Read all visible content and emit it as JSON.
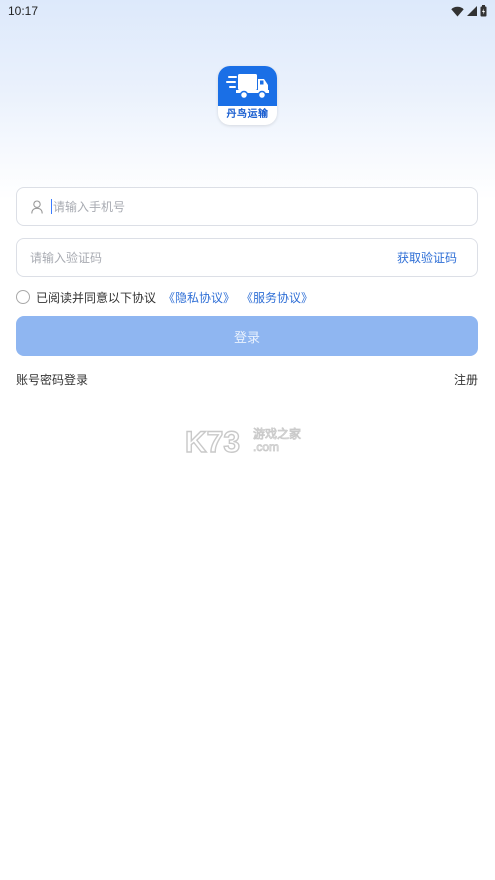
{
  "status_bar": {
    "time": "10:17",
    "icons": [
      "wifi-icon",
      "signal-icon",
      "battery-icon"
    ]
  },
  "app": {
    "logo_text": "丹鸟运输",
    "accent_color": "#1a6fe6"
  },
  "form": {
    "phone_placeholder": "请输入手机号",
    "code_placeholder": "请输入验证码",
    "get_code_label": "获取验证码",
    "agreement_text": "已阅读并同意以下协议",
    "privacy_link": "《隐私协议》",
    "service_link": "《服务协议》",
    "agreement_checked": false,
    "login_label": "登录"
  },
  "footer_links": {
    "password_login": "账号密码登录",
    "register": "注册"
  },
  "watermark": {
    "brand": "K73",
    "cn_text": "游戏之家",
    "domain": ".com"
  }
}
